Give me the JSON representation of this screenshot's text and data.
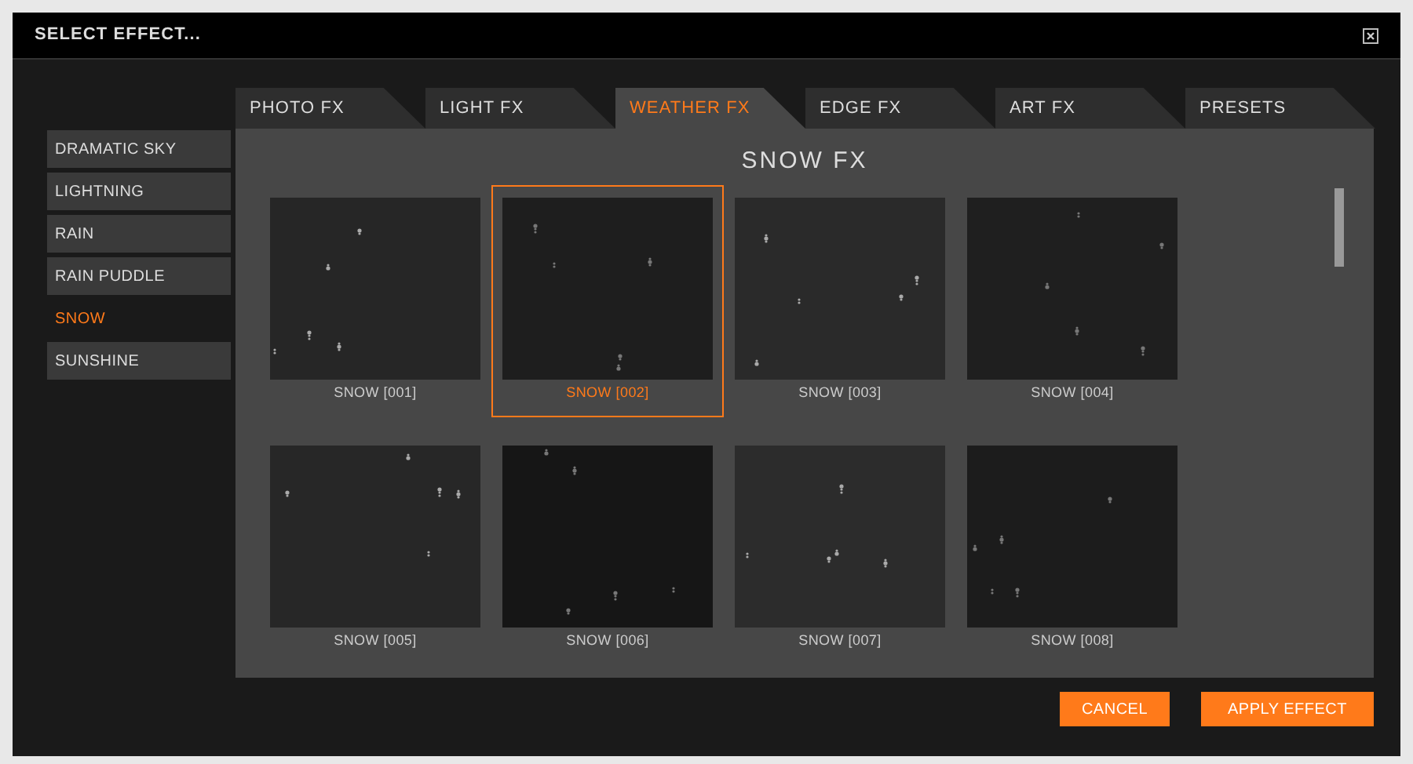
{
  "window": {
    "title": "SELECT EFFECT..."
  },
  "tabs": [
    {
      "label": "PHOTO FX",
      "selected": false
    },
    {
      "label": "LIGHT FX",
      "selected": false
    },
    {
      "label": "WEATHER FX",
      "selected": true
    },
    {
      "label": "EDGE FX",
      "selected": false
    },
    {
      "label": "ART FX",
      "selected": false
    },
    {
      "label": "PRESETS",
      "selected": false
    }
  ],
  "sidebar": {
    "items": [
      {
        "label": "DRAMATIC SKY",
        "selected": false
      },
      {
        "label": "LIGHTNING",
        "selected": false
      },
      {
        "label": "RAIN",
        "selected": false
      },
      {
        "label": "RAIN PUDDLE",
        "selected": false
      },
      {
        "label": "SNOW",
        "selected": true
      },
      {
        "label": "SUNSHINE",
        "selected": false
      }
    ]
  },
  "panel": {
    "title": "SNOW FX"
  },
  "effects": [
    {
      "label": "SNOW [001]",
      "selected": false
    },
    {
      "label": "SNOW [002]",
      "selected": true
    },
    {
      "label": "SNOW [003]",
      "selected": false
    },
    {
      "label": "SNOW [004]",
      "selected": false
    },
    {
      "label": "SNOW [005]",
      "selected": false
    },
    {
      "label": "SNOW [006]",
      "selected": false
    },
    {
      "label": "SNOW [007]",
      "selected": false
    },
    {
      "label": "SNOW [008]",
      "selected": false
    }
  ],
  "buttons": [
    {
      "label": "CANCEL"
    },
    {
      "label": "APPLY EFFECT"
    }
  ]
}
